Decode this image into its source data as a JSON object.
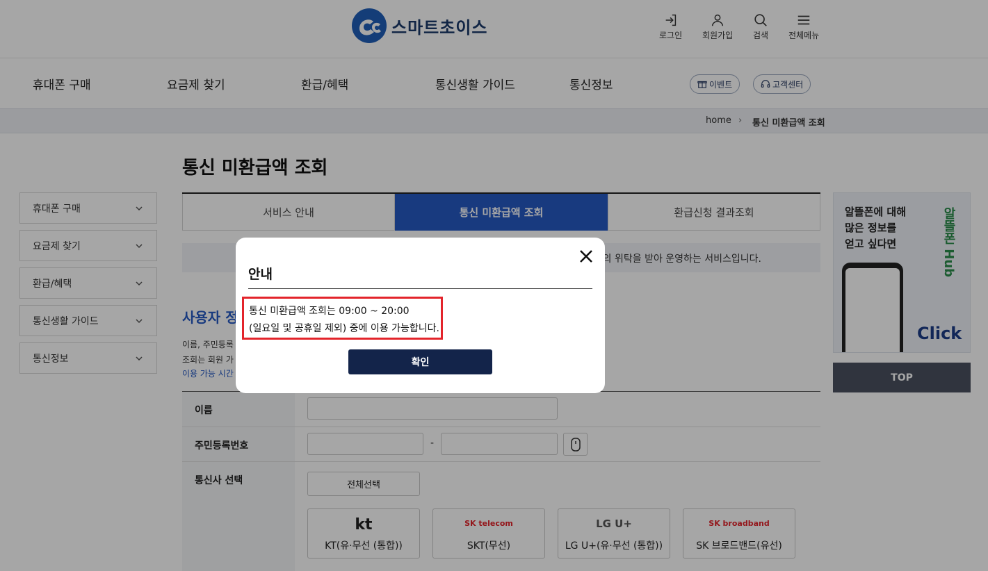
{
  "header": {
    "logo_text": "스마트초이스",
    "utility": [
      {
        "label": "로그인",
        "icon": "login-icon"
      },
      {
        "label": "회원가입",
        "icon": "user-icon"
      },
      {
        "label": "검색",
        "icon": "search-icon"
      },
      {
        "label": "전체메뉴",
        "icon": "menu-icon"
      }
    ]
  },
  "gnb": {
    "items": [
      "휴대폰 구매",
      "요금제 찾기",
      "환급/혜택",
      "통신생활 가이드",
      "통신정보"
    ],
    "event_label": "이벤트",
    "support_label": "고객센터"
  },
  "breadcrumb": {
    "home": "home",
    "current": "통신 미환급액 조회"
  },
  "page": {
    "title": "통신 미환급액 조회"
  },
  "sidebar": {
    "items": [
      "휴대폰 구매",
      "요금제 찾기",
      "환급/혜택",
      "통신생활 가이드",
      "통신정보"
    ]
  },
  "tabs": [
    "서비스 안내",
    "통신 미환급액 조회",
    "환급신청 결과조회"
  ],
  "notice_strip": "의 위탁을 받아 운영하는 서비스입니다.",
  "section": {
    "title": "사용자 정",
    "line1": "이름, 주민등록",
    "line2": "조회는 회원 가",
    "line3": "이용 가능 시간"
  },
  "form": {
    "name_label": "이름",
    "rrn_label": "주민등록번호",
    "rrn_dash": "-",
    "carrier_label": "통신사 선택",
    "select_all": "전체선택",
    "carriers": [
      {
        "logo": "kt",
        "name": "KT(유·무선 (통합))"
      },
      {
        "logo": "SK telecom",
        "name": "SKT(무선)"
      },
      {
        "logo": "LG U+",
        "name": "LG U+(유·무선 (통합))"
      },
      {
        "logo": "SK broadband",
        "name": "SK 브로드밴드(유선)"
      }
    ]
  },
  "banner": {
    "line1": "알뜰폰에 대해",
    "line2": "많은 정보를",
    "line3": "얻고 싶다면",
    "brand": "알뜰폰 Hub",
    "click": "Click"
  },
  "top_button": "TOP",
  "modal": {
    "title": "안내",
    "message_line1": "통신 미환급액 조회는 09:00 ~ 20:00",
    "message_line2": "(일요일 및 공휴일 제외) 중에 이용 가능합니다.",
    "confirm_label": "확인"
  },
  "colors": {
    "primary": "#2659c3",
    "navy": "#13244a",
    "highlight": "#e3242b"
  }
}
